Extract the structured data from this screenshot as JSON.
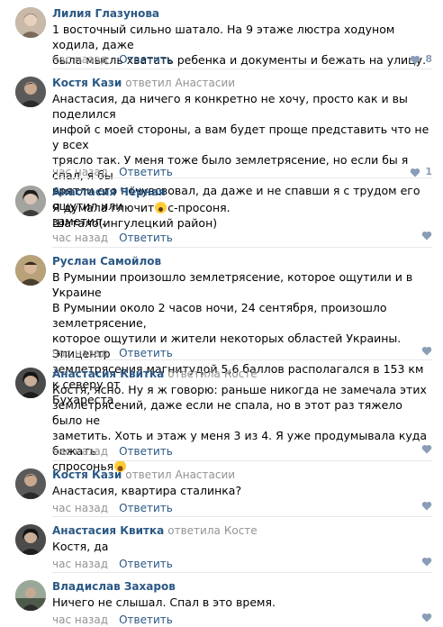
{
  "comments": [
    {
      "author": "Лилия Глазунова",
      "replied": "",
      "reply_to": "",
      "text": "1 восточный сильно шатало. На 9 этаже люстра ходуном ходила, даже\nбыла мысль хватать ребенка и документы и бежать на улицу.",
      "time": "час назад",
      "reply_label": "Ответить",
      "likes": "8"
    },
    {
      "author": "Костя Кази",
      "replied": "ответил",
      "reply_to": "Анастасии",
      "text": "Анастасия, да ничего я конкретно не хочу, просто как и вы поделился\nинфой с моей стороны, а вам будет проще представить что не у всех\nтрясло так. У меня тоже было землетрясение, но если бы я спал, я бы\nврятли его почувсвовал, да даже и не спавши я с трудом его ощутил или\nзаметил.",
      "time": "час назад",
      "reply_label": "Ответить",
      "likes": "1"
    },
    {
      "author": "Анастасия Чёрная",
      "replied": "",
      "reply_to": "",
      "text_before": "Я думала глючит",
      "text_after": "с-просоня.\nШатало(ингулецкий район)",
      "time": "час назад",
      "reply_label": "Ответить",
      "likes": ""
    },
    {
      "author": "Руслан Самойлов",
      "replied": "",
      "reply_to": "",
      "text": "В Румынии произошло землетрясение, которое ощутили и в Украине\nВ Румынии около 2 часов ночи, 24 сентября, произошло землетрясение,\nкоторое ощутили и жители некоторых областей Украины. Эпицентр\nземлетрясения магнитудой 5,6 баллов располагался в 153 км к северу от\nБухареста",
      "time": "час назад",
      "reply_label": "Ответить",
      "likes": ""
    },
    {
      "author": "Анастасия Квитка",
      "replied": "ответила",
      "reply_to": "Косте",
      "text_before": "Костя, ясно. Ну я ж говорю: раньше никогда не замечала этих\nземлетрясений, даже если не спала, но в этот раз тяжело было не\nзаметить. Хоть и этаж у меня 3 из 4. Я уже продумывала куда бежать\nспросонья",
      "text_after": "",
      "time": "час назад",
      "reply_label": "Ответить",
      "likes": ""
    },
    {
      "author": "Костя Кази",
      "replied": "ответил",
      "reply_to": "Анастасии",
      "text": "Анастасия, квартира сталинка?",
      "time": "час назад",
      "reply_label": "Ответить",
      "likes": ""
    },
    {
      "author": "Анастасия Квитка",
      "replied": "ответила",
      "reply_to": "Косте",
      "text": "Костя, да",
      "time": "час назад",
      "reply_label": "Ответить",
      "likes": ""
    },
    {
      "author": "Владислав Захаров",
      "replied": "",
      "reply_to": "",
      "text": "Ничего не слышал. Спал в это время.",
      "time": "час назад",
      "reply_label": "Ответить",
      "likes": ""
    }
  ],
  "colors": {
    "author": "#2a5885",
    "muted": "#939393",
    "like": "#8a9db6",
    "separator": "#e7e8ec"
  },
  "icons": {
    "like": "heart-icon",
    "emoji_scream": "scream-emoji-icon",
    "emoji_laugh": "laughing-emoji-icon"
  }
}
